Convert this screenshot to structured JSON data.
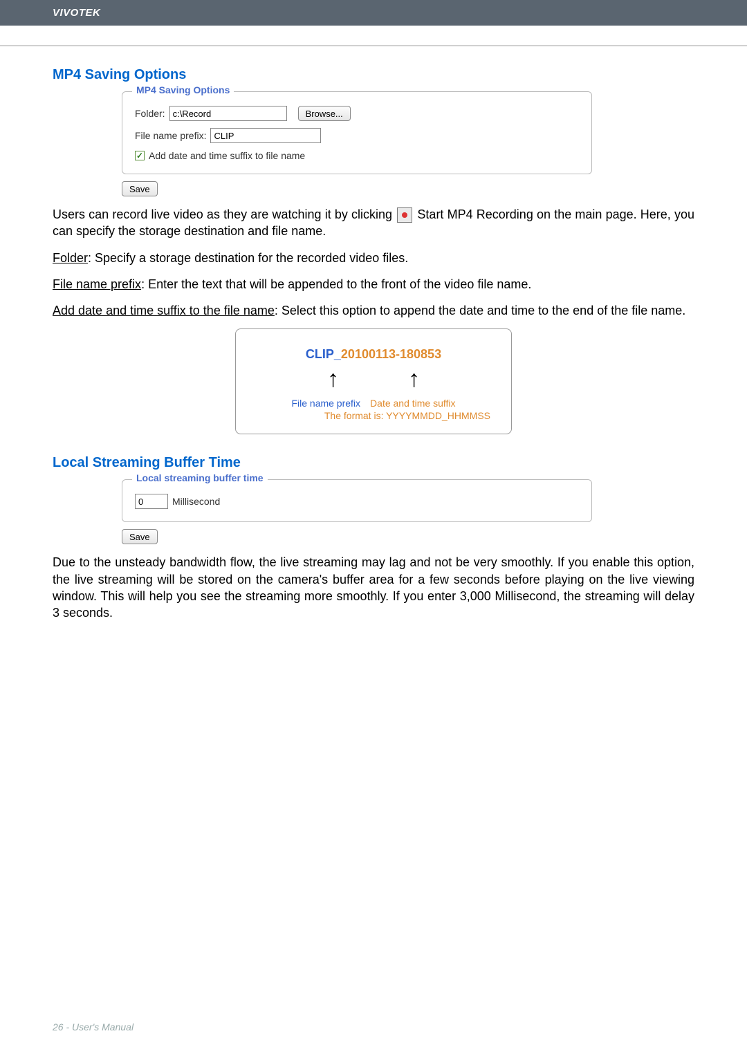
{
  "header": {
    "brand": "VIVOTEK"
  },
  "mp4": {
    "section_title": "MP4 Saving Options",
    "panel_legend": "MP4 Saving Options",
    "folder_label": "Folder:",
    "folder_value": "c:\\Record",
    "browse_label": "Browse...",
    "prefix_label": "File name prefix:",
    "prefix_value": "CLIP",
    "suffix_checkbox_label": "Add date and time suffix to file name",
    "save_label": "Save",
    "desc_part1": "Users can record live video as they are watching it by clicking",
    "desc_part2": "Start MP4 Recording on the main page. Here, you can specify the storage destination and file name.",
    "folder_help_label": "Folder",
    "folder_help_text": ": Specify a storage destination for the recorded video files.",
    "prefix_help_label": "File name prefix",
    "prefix_help_text": ": Enter the text that will be appended to the front of the video file name.",
    "suffix_help_label": "Add date and time suffix to the file name",
    "suffix_help_text": ": Select this option to append the date and time to the end of the file name."
  },
  "diagram": {
    "prefix_part": "CLIP_",
    "date_part": "20100113-180853",
    "label_prefix": "File name prefix",
    "label_suffix": "Date and time suffix",
    "label_format": "The format is: YYYYMMDD_HHMMSS"
  },
  "buffer": {
    "section_title": "Local Streaming Buffer Time",
    "panel_legend": "Local streaming buffer time",
    "value": "0",
    "unit": "Millisecond",
    "save_label": "Save",
    "desc": "Due to the unsteady bandwidth flow, the live streaming may lag and not be very smoothly. If you enable this option, the live streaming will be stored on the camera's buffer area for a few seconds before playing on the live viewing window. This will help you see the streaming more smoothly. If you enter 3,000 Millisecond, the streaming will delay 3 seconds."
  },
  "footer": {
    "text": "26 - User's Manual"
  }
}
